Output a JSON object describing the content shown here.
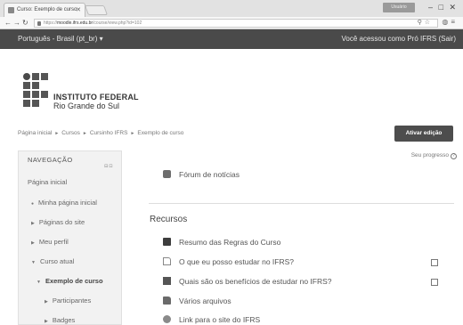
{
  "browser": {
    "tab_title": "Curso: Exemplo de curso",
    "url_prefix": "https://",
    "url_host": "moodle.ifrs.edu.br",
    "url_path": "/course/view.php?id=102",
    "user_badge": "Usuário"
  },
  "navbar": {
    "language": "Português - Brasil (pt_br) ▾",
    "login_status": "Você acessou como Pró IFRS (Sair)"
  },
  "logo": {
    "title": "INSTITUTO FEDERAL",
    "subtitle": "Rio Grande do Sul"
  },
  "breadcrumb": [
    "Página inicial",
    "Cursos",
    "Cursinho IFRS",
    "Exemplo de curso"
  ],
  "edit_button": "Ativar edição",
  "navigation": {
    "title": "NAVEGAÇÃO",
    "home": "Página inicial",
    "my_home": "Minha página inicial",
    "site_pages": "Páginas do site",
    "my_profile": "Meu perfil",
    "current_course": "Curso atual",
    "course_name": "Exemplo de curso",
    "participants": "Participantes",
    "badges": "Badges"
  },
  "progress_label": "Seu progresso",
  "forum": "Fórum de notícias",
  "section_title": "Recursos",
  "activities": [
    {
      "label": "Resumo das Regras do Curso",
      "icon": "book-icon",
      "checkbox": false
    },
    {
      "label": "O que eu posso estudar no IFRS?",
      "icon": "file-icon",
      "checkbox": true
    },
    {
      "label": "Quais são os benefícios de estudar no IFRS?",
      "icon": "pdf-icon",
      "checkbox": true
    },
    {
      "label": "Vários arquivos",
      "icon": "folder-icon",
      "checkbox": false
    },
    {
      "label": "Link para o site do IFRS",
      "icon": "url-icon",
      "checkbox": false
    }
  ]
}
